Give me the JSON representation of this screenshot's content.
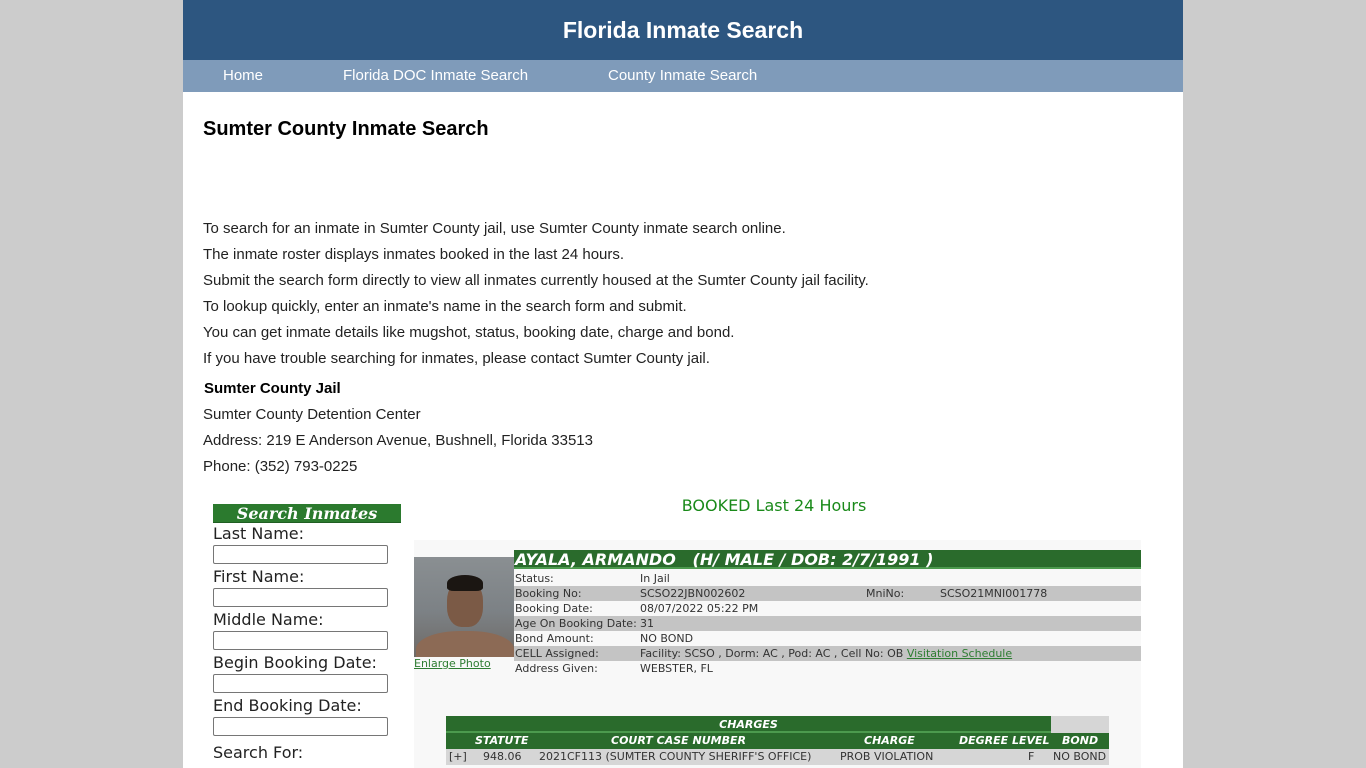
{
  "header": {
    "title": "Florida Inmate Search"
  },
  "nav": {
    "items": [
      {
        "label": "Home"
      },
      {
        "label": "Florida DOC Inmate Search"
      },
      {
        "label": "County Inmate Search"
      }
    ]
  },
  "page": {
    "title": "Sumter County Inmate Search",
    "intro": [
      "To search for an inmate in Sumter County jail, use Sumter County inmate search online.",
      "The inmate roster displays inmates booked in the last 24 hours.",
      "Submit the search form directly to view all inmates currently housed at the Sumter County jail facility.",
      "To lookup quickly, enter an inmate's name in the search form and submit.",
      "You can get inmate details like mugshot, status, booking date, charge and bond.",
      "If you have trouble searching for inmates, please contact Sumter County jail."
    ],
    "jail": {
      "name": "Sumter County Jail",
      "facility": "Sumter County Detention Center",
      "address": "Address: 219 E Anderson Avenue, Bushnell, Florida 33513",
      "phone": "Phone: (352) 793-0225"
    }
  },
  "search_form": {
    "title": "Search Inmates",
    "fields": [
      {
        "label": "Last Name:",
        "value": ""
      },
      {
        "label": "First Name:",
        "value": ""
      },
      {
        "label": "Middle Name:",
        "value": ""
      },
      {
        "label": "Begin Booking Date:",
        "value": ""
      },
      {
        "label": "End Booking Date:",
        "value": ""
      }
    ],
    "search_for_label": "Search For:"
  },
  "roster": {
    "title": "BOOKED Last 24 Hours",
    "record": {
      "name_line": "AYALA, ARMANDO   (H/ MALE / DOB: 2/7/1991 )",
      "enlarge_photo": "Enlarge Photo",
      "details": [
        {
          "label": "Status:",
          "value": "In Jail"
        },
        {
          "label": "Booking No:",
          "value": "SCSO22JBN002602",
          "label2": "MniNo:",
          "value2": "SCSO21MNI001778"
        },
        {
          "label": "Booking Date:",
          "value": "08/07/2022 05:22 PM"
        },
        {
          "label": "Age On Booking Date:",
          "value": "31"
        },
        {
          "label": "Bond Amount:",
          "value": "NO BOND"
        },
        {
          "label": "CELL Assigned:",
          "value": "Facility: SCSO , Dorm: AC , Pod: AC , Cell No: OB",
          "link": "Visitation Schedule"
        },
        {
          "label": "Address Given:",
          "value": "WEBSTER, FL"
        }
      ],
      "charges": {
        "title": "CHARGES",
        "columns": [
          "STATUTE",
          "COURT CASE NUMBER",
          "CHARGE",
          "DEGREE LEVEL",
          "BOND"
        ],
        "rows": [
          {
            "expand": "[+]",
            "statute": "948.06",
            "case": "2021CF113 (SUMTER COUNTY SHERIFF'S OFFICE)",
            "charge": "PROB VIOLATION",
            "degree": "F",
            "bond": "NO BOND"
          }
        ]
      }
    }
  }
}
